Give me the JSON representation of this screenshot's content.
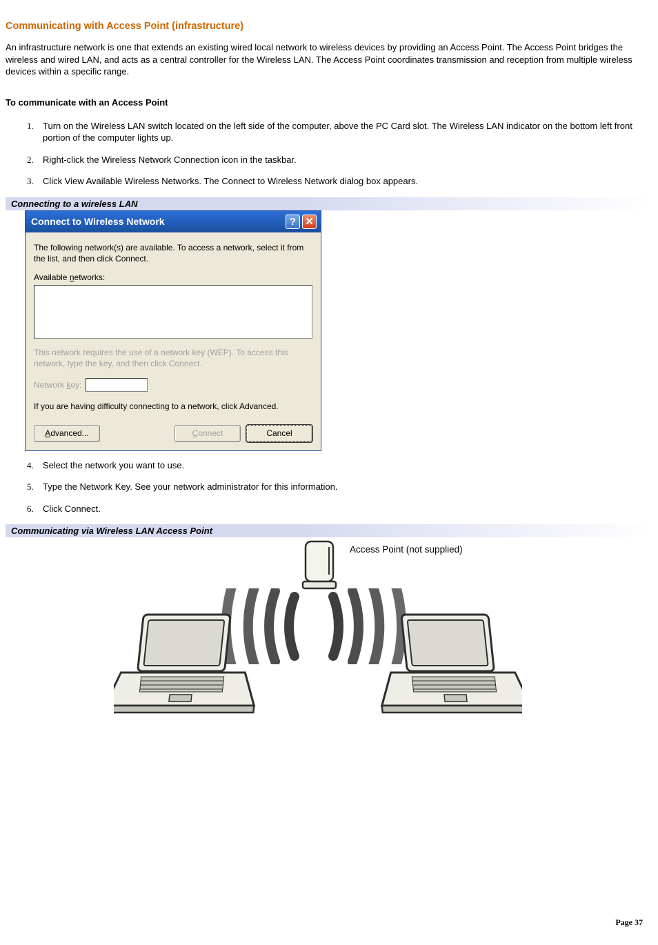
{
  "heading": "Communicating with Access Point (infrastructure)",
  "intro": "An infrastructure network is one that extends an existing wired local network to wireless devices by providing an Access Point. The Access Point bridges the wireless and wired LAN, and acts as a central controller for the Wireless LAN. The Access Point coordinates transmission and reception from multiple wireless devices within a specific range.",
  "subheading": "To communicate with an Access Point",
  "steps_a": [
    "Turn on the Wireless LAN switch located on the left side of the computer, above the PC Card slot. The Wireless LAN indicator on the bottom left front portion of the computer lights up.",
    "Right-click the Wireless Network Connection icon in the taskbar.",
    "Click View Available Wireless Networks. The Connect to Wireless Network dialog box appears."
  ],
  "figure1_title": "Connecting to a wireless LAN",
  "dialog": {
    "title": "Connect to Wireless Network",
    "intro": "The following network(s) are available. To access a network, select it from the list, and then click Connect.",
    "available_label_pre": "Available ",
    "available_label_ul": "n",
    "available_label_post": "etworks:",
    "wep_text": "This network requires the use of a network key (WEP). To access this network, type the key, and then click Connect.",
    "key_label_pre": "Network ",
    "key_label_ul": "k",
    "key_label_post": "ey:",
    "advice": "If you are having difficulty connecting to a network, click Advanced.",
    "advanced_ul": "A",
    "advanced_post": "dvanced...",
    "connect_ul": "C",
    "connect_post": "onnect",
    "cancel": "Cancel"
  },
  "steps_b": [
    "Select the network you want to use.",
    "Type the Network Key. See your network administrator for this information.",
    "Click Connect."
  ],
  "figure2_title": "Communicating via Wireless LAN Access Point",
  "diagram_ap_label": "Access Point (not supplied)",
  "page_footer": "Page 37"
}
